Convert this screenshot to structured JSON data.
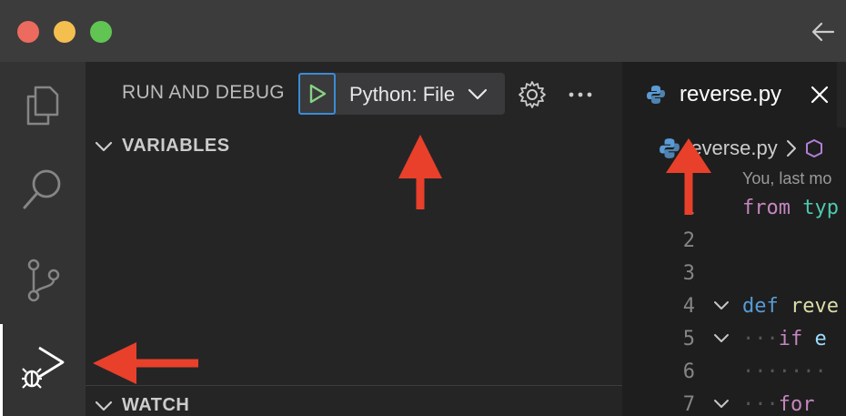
{
  "window": {
    "controls": [
      "close",
      "minimize",
      "maximize"
    ]
  },
  "activity_bar": {
    "items": [
      {
        "id": "explorer",
        "icon": "files-icon"
      },
      {
        "id": "search",
        "icon": "search-icon"
      },
      {
        "id": "source-control",
        "icon": "source-control-icon"
      },
      {
        "id": "run-and-debug",
        "icon": "run-debug-icon",
        "active": true
      }
    ]
  },
  "sidebar": {
    "title": "RUN AND DEBUG",
    "config_label": "Python: File",
    "sections": {
      "variables": "VARIABLES",
      "watch": "WATCH"
    }
  },
  "editor": {
    "tab_label": "reverse.py",
    "breadcrumb_file": "reverse.py",
    "blame": "You, last mo",
    "lines": [
      {
        "num": "1"
      },
      {
        "num": "2"
      },
      {
        "num": "3"
      },
      {
        "num": "4"
      },
      {
        "num": "5"
      },
      {
        "num": "6"
      },
      {
        "num": "7"
      }
    ],
    "tokens": {
      "l1_kw": "from",
      "l1_type": "typ",
      "l4_kw": "def",
      "l4_fn": "reve",
      "l5_ws": "···",
      "l5_kw": "if",
      "l5_id": "e",
      "l6_ws": "·······",
      "l7_ws": "···",
      "l7_kw": "for"
    }
  },
  "colors": {
    "accent_blue": "#3b8bd8",
    "play_green": "#89d185",
    "annotation_red": "#e8402a"
  }
}
